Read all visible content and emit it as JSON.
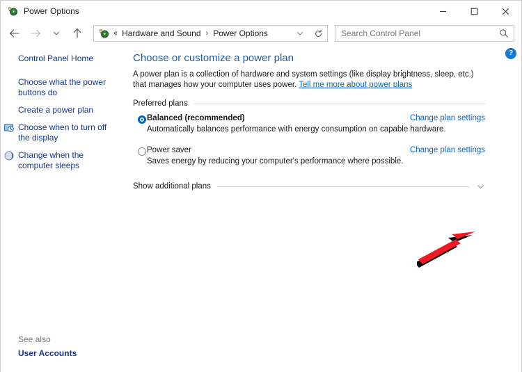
{
  "window": {
    "title": "Power Options",
    "title_icon": "power-plug-icon",
    "controls": {
      "minimize": "minimize-button",
      "maximize": "maximize-button",
      "close": "close-button"
    }
  },
  "toolbar": {
    "back": "back-arrow-icon",
    "forward": "forward-arrow-icon",
    "recent": "chevron-down-icon",
    "up": "up-arrow-icon",
    "address": {
      "icon": "power-plug-icon",
      "leading_separator": "«",
      "crumbs": [
        "Hardware and Sound",
        "Power Options"
      ],
      "separator": "›",
      "dropdown": "chevron-down-icon",
      "refresh": "refresh-icon"
    },
    "search": {
      "placeholder": "Search Control Panel",
      "icon": "search-icon"
    }
  },
  "sidebar": {
    "items": [
      {
        "label": "Control Panel Home",
        "icon": null
      },
      {
        "label": "Choose what the power buttons do",
        "icon": null
      },
      {
        "label": "Create a power plan",
        "icon": null
      },
      {
        "label": "Choose when to turn off the display",
        "icon": "display-clock-icon"
      },
      {
        "label": "Change when the computer sleeps",
        "icon": "moon-sleep-icon"
      }
    ],
    "see_also": {
      "title": "See also",
      "links": [
        "User Accounts"
      ]
    }
  },
  "main": {
    "heading": "Choose or customize a power plan",
    "description_part1": "A power plan is a collection of hardware and system settings (like display brightness, sleep, etc.) that manages how your computer uses power. ",
    "description_link": "Tell me more about power plans",
    "group_label": "Preferred plans",
    "plans": [
      {
        "name": "Balanced (recommended)",
        "description": "Automatically balances performance with energy consumption on capable hardware.",
        "selected": true,
        "link": "Change plan settings"
      },
      {
        "name": "Power saver",
        "description": "Saves energy by reducing your computer's performance where possible.",
        "selected": false,
        "link": "Change plan settings"
      }
    ],
    "show_additional": {
      "label": "Show additional plans",
      "chevron": "chevron-down-icon"
    },
    "help": {
      "label": "?",
      "icon": "help-question-icon"
    }
  },
  "annotation": {
    "arrow": "red-pointer-arrow",
    "color": "#ee1b24",
    "shadow_color": "#000000",
    "points_to": "show-additional-plans-chevron"
  },
  "colors": {
    "heading": "#1f5aa8",
    "sidebar_link": "#16368c",
    "content_link": "#0b63ce",
    "radio_accent": "#0067c0",
    "help_badge": "#1279d4",
    "rule": "#d7d7d7",
    "muted_text": "#767676"
  }
}
